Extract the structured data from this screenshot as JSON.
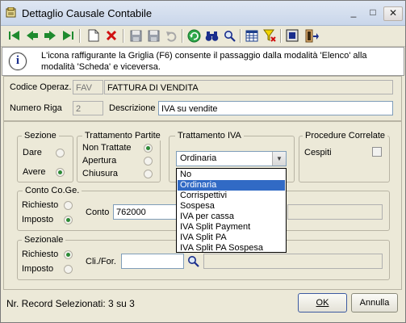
{
  "window": {
    "title": "Dettaglio Causale Contabile",
    "minimize": "_",
    "maximize": "□",
    "close": "✕"
  },
  "info": {
    "text": "L'icona raffigurante la Griglia (F6) consente il passaggio dalla modalità 'Elenco' alla modalità 'Scheda' e viceversa."
  },
  "header": {
    "codice_label": "Codice Operaz.",
    "codice_value": "FAV",
    "codice_desc": "FATTURA DI VENDITA",
    "numero_label": "Numero Riga",
    "numero_value": "2",
    "descrizione_label": "Descrizione",
    "descrizione_value": "IVA su vendite"
  },
  "sezione": {
    "title": "Sezione",
    "dare": "Dare",
    "avere": "Avere"
  },
  "trattamento_partite": {
    "title": "Trattamento Partite",
    "non_trattate": "Non Trattate",
    "apertura": "Apertura",
    "chiusura": "Chiusura"
  },
  "trattamento_iva": {
    "title": "Trattamento IVA",
    "selected": "Ordinaria",
    "options": [
      "No",
      "Ordinaria",
      "Corrispettivi",
      "Sospesa",
      "IVA per cassa",
      "IVA Split Payment",
      "IVA Split PA",
      "IVA Split PA Sospesa"
    ]
  },
  "procedure": {
    "title": "Procedure Correlate",
    "cespiti": "Cespiti"
  },
  "conto": {
    "title": "Conto Co.Ge.",
    "richiesto": "Richiesto",
    "imposto": "Imposto",
    "conto_label": "Conto",
    "conto_value": "762000"
  },
  "sezionale": {
    "title": "Sezionale",
    "richiesto": "Richiesto",
    "imposto": "Imposto",
    "clifor_label": "Cli./For.",
    "clifor_value": ""
  },
  "footer": {
    "status": "Nr. Record Selezionati: 3 su 3",
    "ok": "OK",
    "annulla": "Annulla"
  },
  "colors": {
    "accent": "#316ac5",
    "radio_dot": "#2c8a36",
    "titlebar": "#c9d6ea"
  }
}
